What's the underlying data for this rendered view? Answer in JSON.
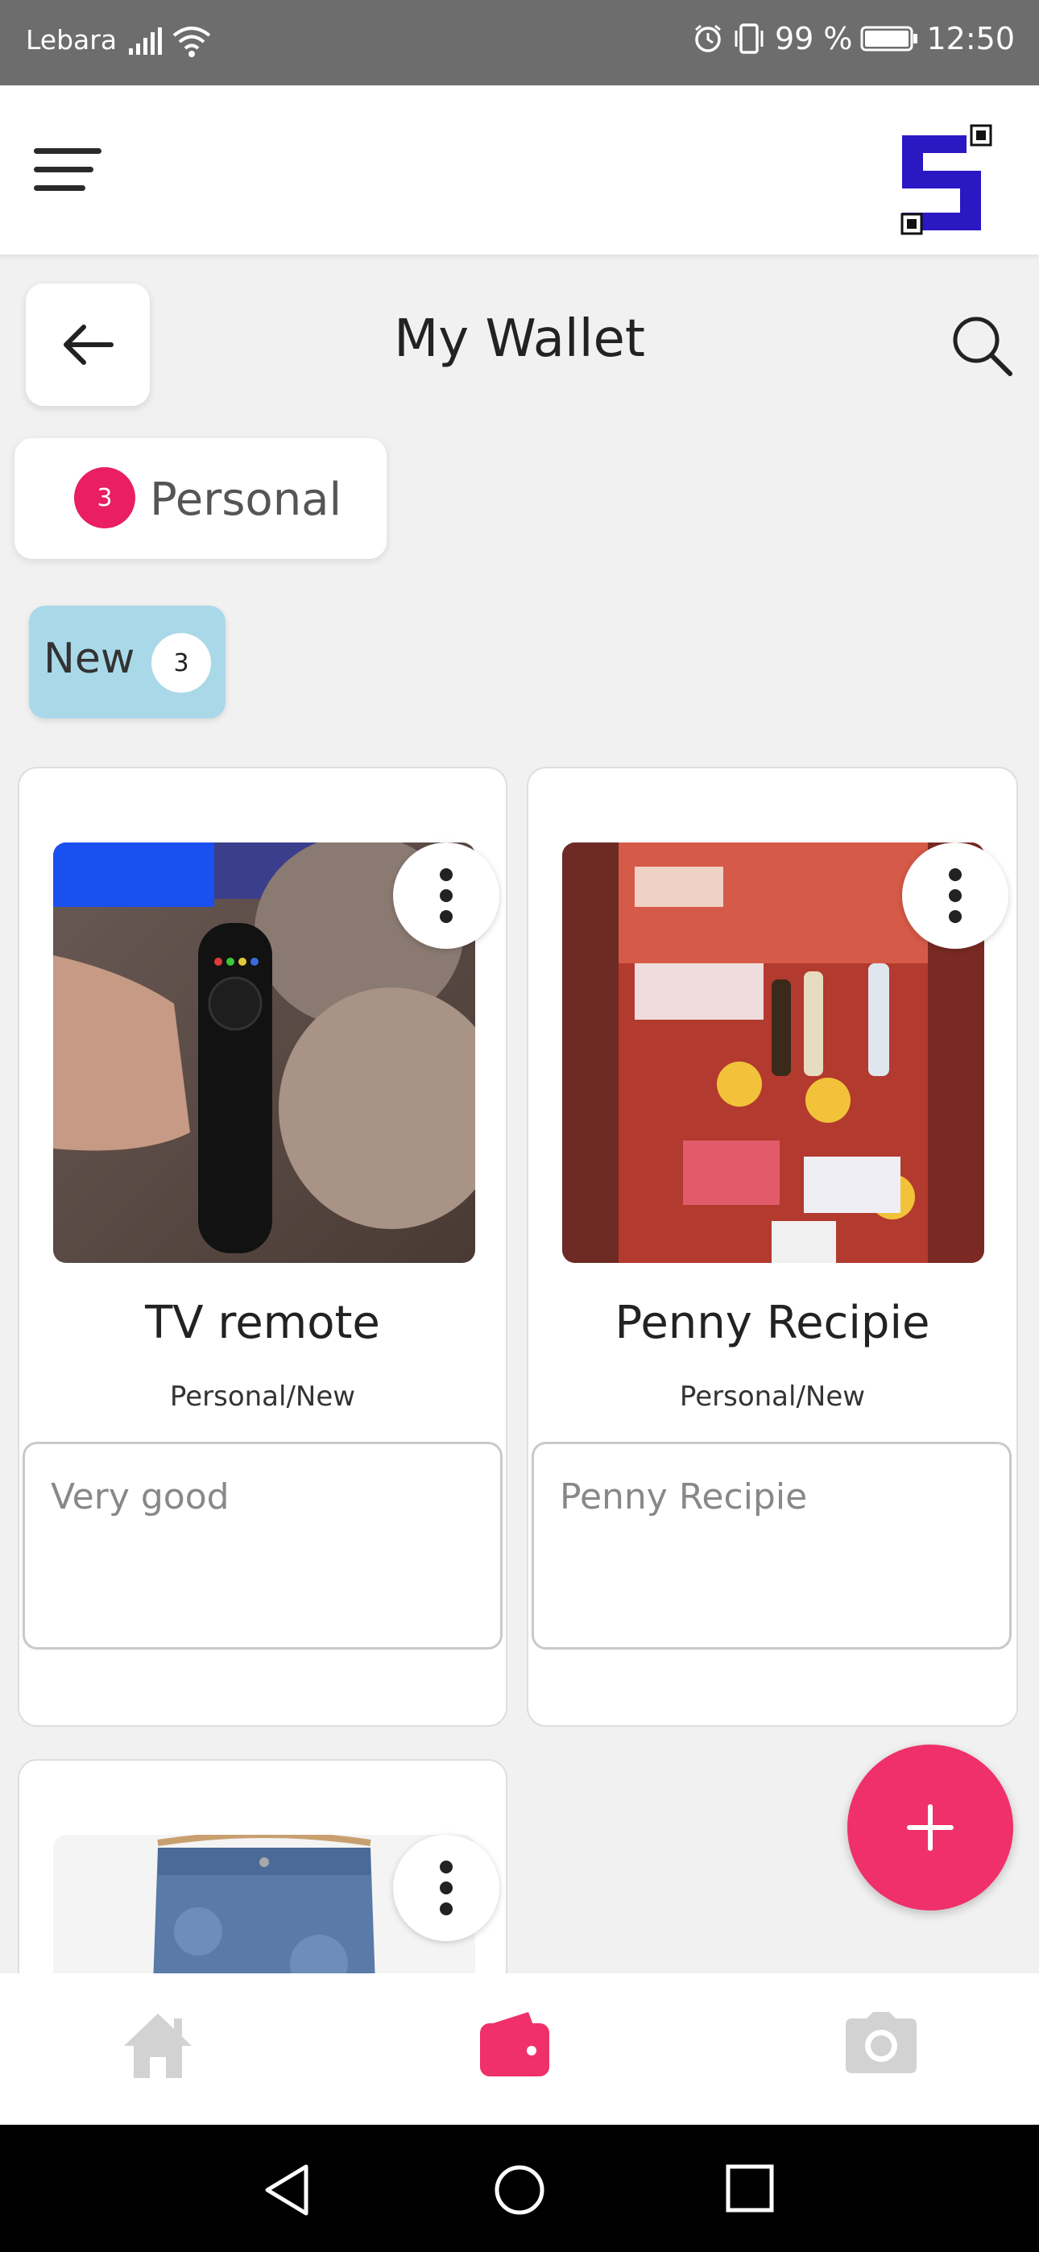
{
  "status_bar": {
    "carrier": "Lebara",
    "battery": "99 %",
    "time": "12:50",
    "icons": [
      "signal-icon",
      "wifi-icon",
      "alarm-icon",
      "vibrate-icon",
      "battery-icon"
    ]
  },
  "app_bar": {
    "menu_icon": "hamburger-menu-icon",
    "logo": "app-logo"
  },
  "page": {
    "title": "My Wallet",
    "back_icon": "arrow-left-icon",
    "search_icon": "search-icon"
  },
  "categories": {
    "personal": {
      "count": "3",
      "label": "Personal"
    },
    "new": {
      "label": "New",
      "count": "3"
    }
  },
  "cards": [
    {
      "title": "TV remote",
      "path": "Personal/New",
      "note": "Very good"
    },
    {
      "title": "Penny Recipie",
      "path": "Personal/New",
      "note": "Penny Recipie"
    }
  ],
  "fab": {
    "icon": "plus-icon"
  },
  "bottom_nav": {
    "items": [
      "home-icon",
      "wallet-icon",
      "camera-icon"
    ],
    "active_color": "#f0306a",
    "inactive_color": "#d2d2d2"
  },
  "colors": {
    "accent": "#e91e63",
    "chip_new_bg": "#a9d9e9",
    "logo_blue": "#2a18c2"
  }
}
